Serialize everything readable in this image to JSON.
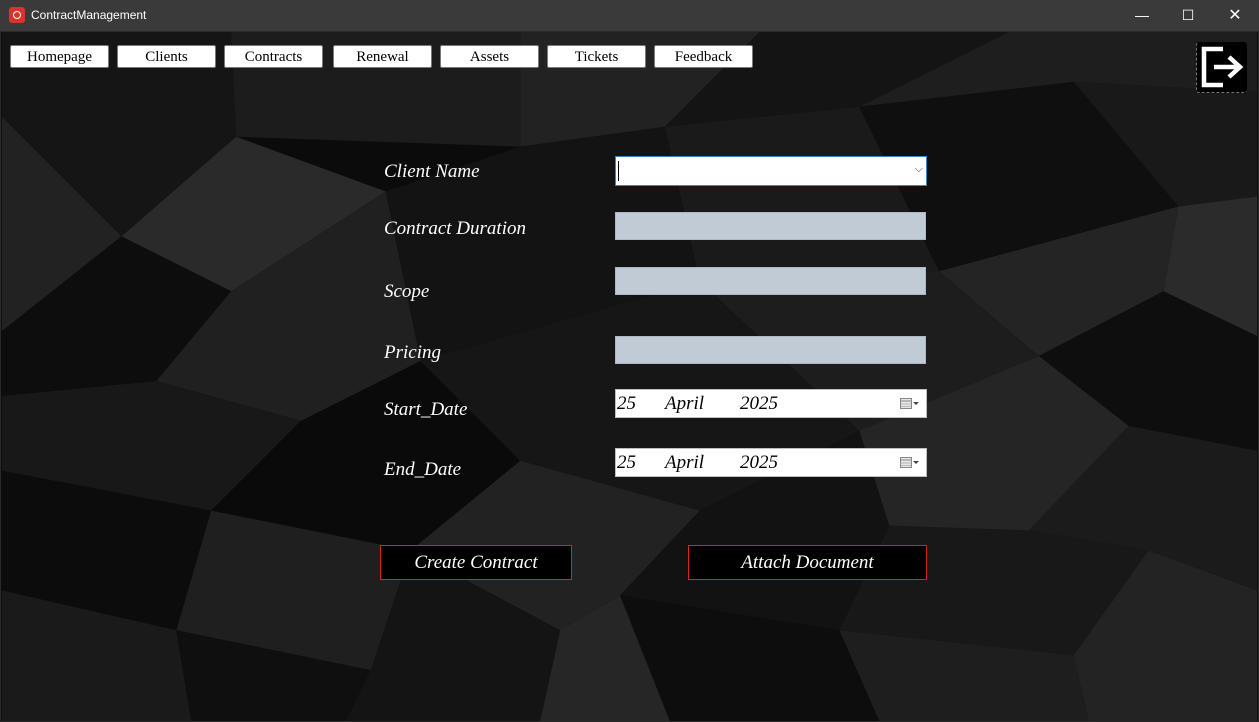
{
  "window": {
    "title": "ContractManagement",
    "controls": {
      "minimize": "—",
      "maximize": "☐",
      "close": "✕"
    }
  },
  "nav": {
    "items": [
      {
        "label": "Homepage"
      },
      {
        "label": "Clients"
      },
      {
        "label": "Contracts"
      },
      {
        "label": "Renewal"
      },
      {
        "label": "Assets"
      },
      {
        "label": "Tickets"
      },
      {
        "label": "Feedback"
      }
    ],
    "logout_icon": "logout-icon"
  },
  "form": {
    "client_name": {
      "label": "Client Name",
      "value": ""
    },
    "contract_duration": {
      "label": "Contract Duration",
      "value": ""
    },
    "scope": {
      "label": "Scope",
      "value": ""
    },
    "pricing": {
      "label": "Pricing",
      "value": ""
    },
    "start_date": {
      "label": "Start_Date",
      "day": "25",
      "month": "April",
      "year": "2025"
    },
    "end_date": {
      "label": "End_Date",
      "day": "25",
      "month": "April",
      "year": "2025"
    }
  },
  "actions": {
    "create": "Create Contract",
    "attach": "Attach Document"
  },
  "colors": {
    "titlebar": "#3a3a3a",
    "input_fill": "#c0cbd6",
    "button_border": "#d92323",
    "focus_border": "#3a86c4"
  }
}
